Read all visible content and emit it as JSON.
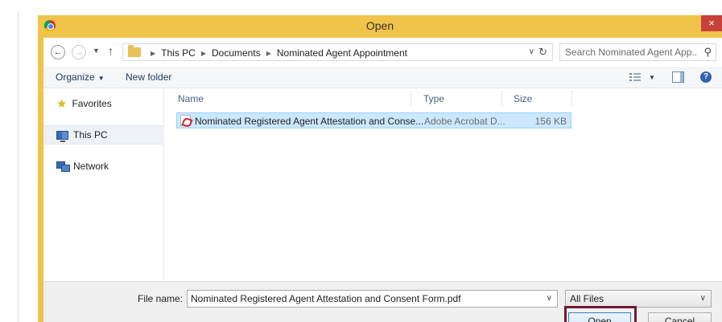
{
  "window": {
    "title": "Open",
    "close_glyph": "×"
  },
  "address_bar": {
    "breadcrumbs": [
      "This PC",
      "Documents",
      "Nominated Agent Appointment"
    ],
    "search_placeholder": "Search Nominated Agent App..."
  },
  "toolbar": {
    "organize_label": "Organize",
    "new_folder_label": "New folder"
  },
  "nav_pane": {
    "items": [
      {
        "label": "Favorites",
        "icon": "star-icon"
      },
      {
        "label": "This PC",
        "icon": "computer-icon"
      },
      {
        "label": "Network",
        "icon": "network-icon"
      }
    ]
  },
  "file_list": {
    "columns": [
      "Name",
      "Type",
      "Size"
    ],
    "rows": [
      {
        "name": "Nominated Registered Agent Attestation and Conse...",
        "type": "Adobe Acrobat D...",
        "size": "156 KB",
        "selected": true,
        "icon": "pdf-file-icon"
      }
    ]
  },
  "footer": {
    "file_name_label": "File name:",
    "file_name_value": "Nominated Registered Agent Attestation and Consent Form.pdf",
    "file_type_selected": "All Files",
    "open_label": "Open",
    "cancel_label": "Cancel"
  },
  "colors": {
    "title_bar": "#f0c34a",
    "close_button": "#c7413a",
    "selection": "#cce8ff",
    "highlight_frame": "#6e1b33"
  }
}
